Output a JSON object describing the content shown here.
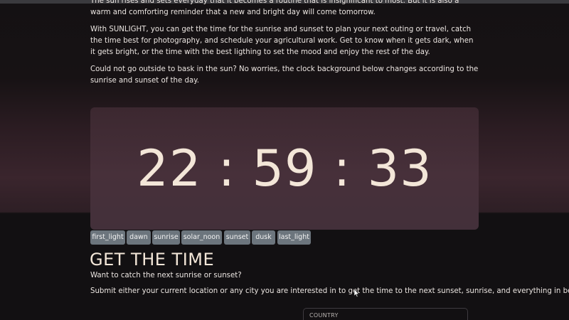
{
  "intro": {
    "paragraph_1": "The sun rises and sets everyday that it becomes a routine that is insignificant to most. But it is also a warm and comforting reminder that a new and bright day will come tomorrow.",
    "paragraph_2": "With SUNLIGHT, you can get the time for the sunrise and sunset to plan your next outing or travel, catch the time best for photography, and schedule your agricultural work. Get to know when it gets dark, when it gets bright, or the time with the best ligthing to set the mood and enjoy the rest of the day.",
    "paragraph_3": "Could not go outside to bask in the sun? No worries, the clock background below changes according to the sunrise and sunset of the day."
  },
  "clock": {
    "time": "22 : 59 : 33"
  },
  "phase_buttons": [
    {
      "label": "first_light"
    },
    {
      "label": "dawn"
    },
    {
      "label": "sunrise"
    },
    {
      "label": "solar_noon"
    },
    {
      "label": "sunset"
    },
    {
      "label": "dusk"
    },
    {
      "label": "last_light"
    }
  ],
  "get_time": {
    "title": "GET THE TIME",
    "subtitle": "Want to catch the next sunrise or sunset?",
    "description": "Submit either your current location or any city you are interested in to get the time to the next sunset, sunrise, and everything in between."
  },
  "country_select": {
    "label": "COUNTRY"
  },
  "colors": {
    "background": "#151214",
    "clock_panel": "#43303a",
    "clock_text": "#f3e6d8",
    "button": "#6c757d"
  },
  "icons": {
    "cursor": "mouse-pointer-icon"
  }
}
